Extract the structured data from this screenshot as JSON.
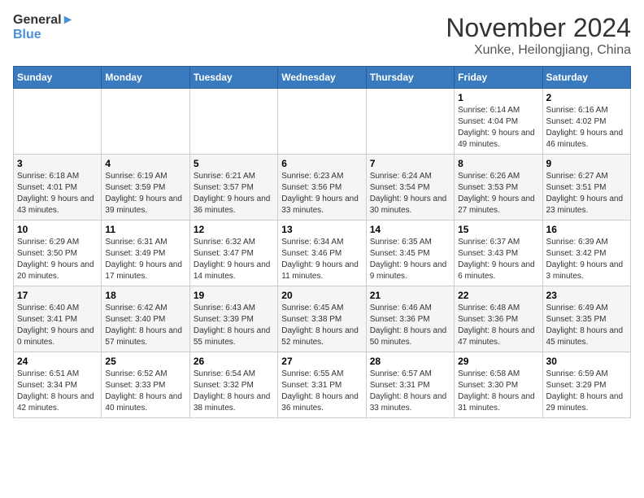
{
  "logo": {
    "line1": "General",
    "line2": "Blue"
  },
  "title": "November 2024",
  "location": "Xunke, Heilongjiang, China",
  "days_of_week": [
    "Sunday",
    "Monday",
    "Tuesday",
    "Wednesday",
    "Thursday",
    "Friday",
    "Saturday"
  ],
  "weeks": [
    [
      {
        "day": "",
        "info": ""
      },
      {
        "day": "",
        "info": ""
      },
      {
        "day": "",
        "info": ""
      },
      {
        "day": "",
        "info": ""
      },
      {
        "day": "",
        "info": ""
      },
      {
        "day": "1",
        "info": "Sunrise: 6:14 AM\nSunset: 4:04 PM\nDaylight: 9 hours and 49 minutes."
      },
      {
        "day": "2",
        "info": "Sunrise: 6:16 AM\nSunset: 4:02 PM\nDaylight: 9 hours and 46 minutes."
      }
    ],
    [
      {
        "day": "3",
        "info": "Sunrise: 6:18 AM\nSunset: 4:01 PM\nDaylight: 9 hours and 43 minutes."
      },
      {
        "day": "4",
        "info": "Sunrise: 6:19 AM\nSunset: 3:59 PM\nDaylight: 9 hours and 39 minutes."
      },
      {
        "day": "5",
        "info": "Sunrise: 6:21 AM\nSunset: 3:57 PM\nDaylight: 9 hours and 36 minutes."
      },
      {
        "day": "6",
        "info": "Sunrise: 6:23 AM\nSunset: 3:56 PM\nDaylight: 9 hours and 33 minutes."
      },
      {
        "day": "7",
        "info": "Sunrise: 6:24 AM\nSunset: 3:54 PM\nDaylight: 9 hours and 30 minutes."
      },
      {
        "day": "8",
        "info": "Sunrise: 6:26 AM\nSunset: 3:53 PM\nDaylight: 9 hours and 27 minutes."
      },
      {
        "day": "9",
        "info": "Sunrise: 6:27 AM\nSunset: 3:51 PM\nDaylight: 9 hours and 23 minutes."
      }
    ],
    [
      {
        "day": "10",
        "info": "Sunrise: 6:29 AM\nSunset: 3:50 PM\nDaylight: 9 hours and 20 minutes."
      },
      {
        "day": "11",
        "info": "Sunrise: 6:31 AM\nSunset: 3:49 PM\nDaylight: 9 hours and 17 minutes."
      },
      {
        "day": "12",
        "info": "Sunrise: 6:32 AM\nSunset: 3:47 PM\nDaylight: 9 hours and 14 minutes."
      },
      {
        "day": "13",
        "info": "Sunrise: 6:34 AM\nSunset: 3:46 PM\nDaylight: 9 hours and 11 minutes."
      },
      {
        "day": "14",
        "info": "Sunrise: 6:35 AM\nSunset: 3:45 PM\nDaylight: 9 hours and 9 minutes."
      },
      {
        "day": "15",
        "info": "Sunrise: 6:37 AM\nSunset: 3:43 PM\nDaylight: 9 hours and 6 minutes."
      },
      {
        "day": "16",
        "info": "Sunrise: 6:39 AM\nSunset: 3:42 PM\nDaylight: 9 hours and 3 minutes."
      }
    ],
    [
      {
        "day": "17",
        "info": "Sunrise: 6:40 AM\nSunset: 3:41 PM\nDaylight: 9 hours and 0 minutes."
      },
      {
        "day": "18",
        "info": "Sunrise: 6:42 AM\nSunset: 3:40 PM\nDaylight: 8 hours and 57 minutes."
      },
      {
        "day": "19",
        "info": "Sunrise: 6:43 AM\nSunset: 3:39 PM\nDaylight: 8 hours and 55 minutes."
      },
      {
        "day": "20",
        "info": "Sunrise: 6:45 AM\nSunset: 3:38 PM\nDaylight: 8 hours and 52 minutes."
      },
      {
        "day": "21",
        "info": "Sunrise: 6:46 AM\nSunset: 3:36 PM\nDaylight: 8 hours and 50 minutes."
      },
      {
        "day": "22",
        "info": "Sunrise: 6:48 AM\nSunset: 3:36 PM\nDaylight: 8 hours and 47 minutes."
      },
      {
        "day": "23",
        "info": "Sunrise: 6:49 AM\nSunset: 3:35 PM\nDaylight: 8 hours and 45 minutes."
      }
    ],
    [
      {
        "day": "24",
        "info": "Sunrise: 6:51 AM\nSunset: 3:34 PM\nDaylight: 8 hours and 42 minutes."
      },
      {
        "day": "25",
        "info": "Sunrise: 6:52 AM\nSunset: 3:33 PM\nDaylight: 8 hours and 40 minutes."
      },
      {
        "day": "26",
        "info": "Sunrise: 6:54 AM\nSunset: 3:32 PM\nDaylight: 8 hours and 38 minutes."
      },
      {
        "day": "27",
        "info": "Sunrise: 6:55 AM\nSunset: 3:31 PM\nDaylight: 8 hours and 36 minutes."
      },
      {
        "day": "28",
        "info": "Sunrise: 6:57 AM\nSunset: 3:31 PM\nDaylight: 8 hours and 33 minutes."
      },
      {
        "day": "29",
        "info": "Sunrise: 6:58 AM\nSunset: 3:30 PM\nDaylight: 8 hours and 31 minutes."
      },
      {
        "day": "30",
        "info": "Sunrise: 6:59 AM\nSunset: 3:29 PM\nDaylight: 8 hours and 29 minutes."
      }
    ]
  ]
}
